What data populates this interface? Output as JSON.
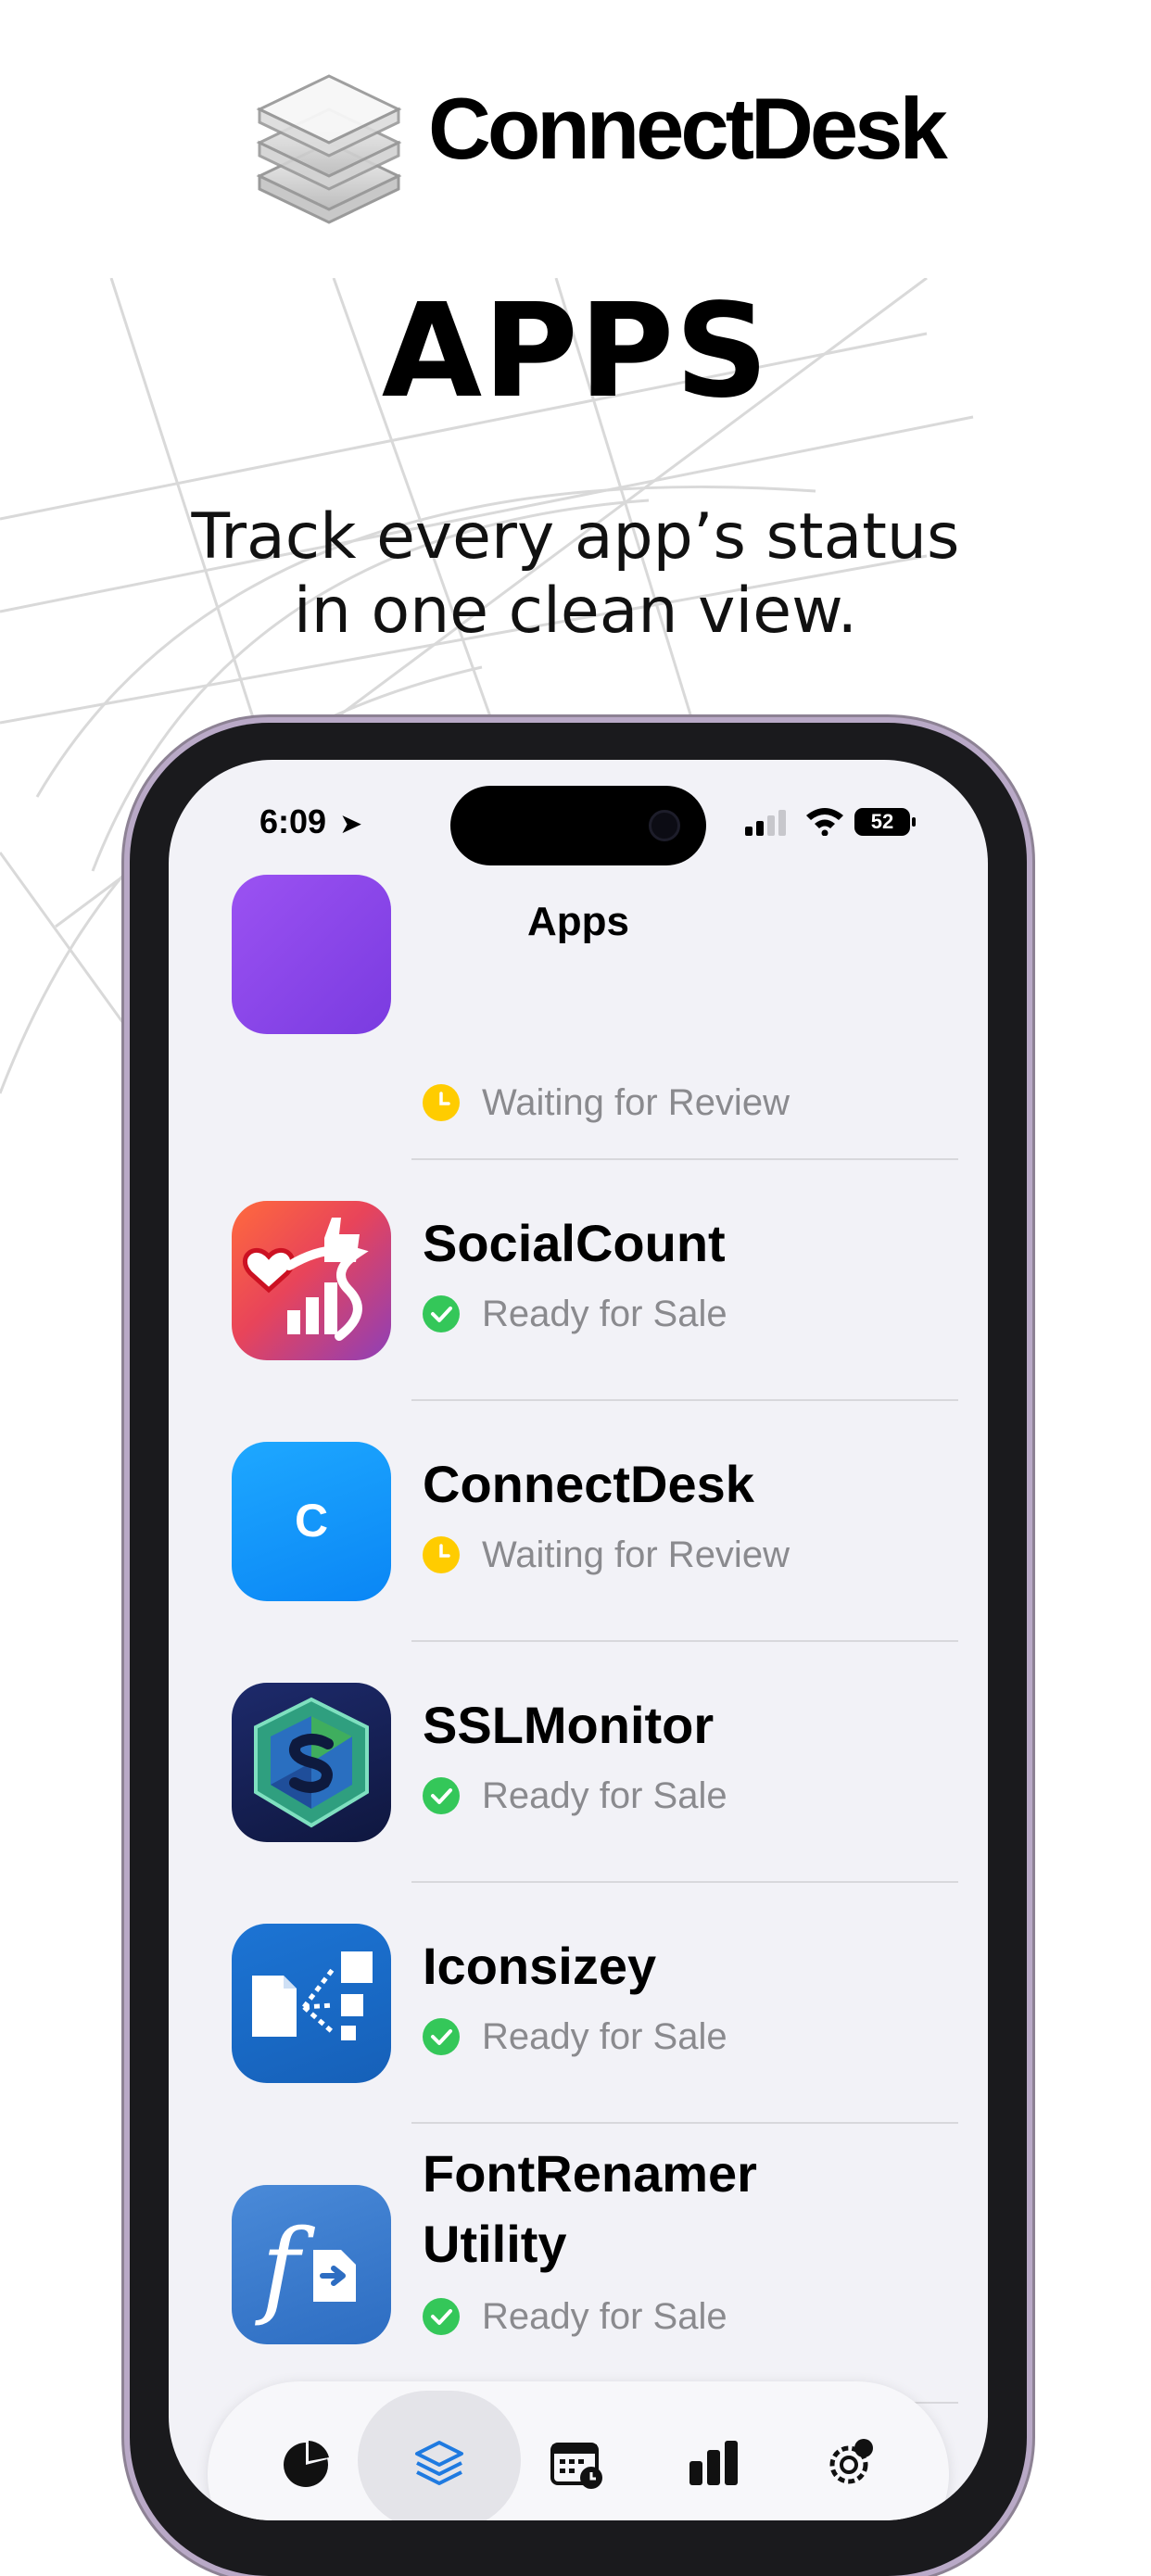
{
  "brand": {
    "name": "ConnectDesk",
    "logo": "stacked-layers-logo"
  },
  "hero": {
    "title": "APPS",
    "subtitle_lines": [
      "Track every app’s status",
      "in one clean view."
    ]
  },
  "status_bar": {
    "time": "6:09",
    "location_icon": "location-arrow-icon",
    "battery": "52"
  },
  "nav": {
    "title": "Apps"
  },
  "apps": [
    {
      "name": "",
      "status": "Waiting for Review",
      "status_color": "#ffcc00",
      "icon": "purple-app-icon"
    },
    {
      "name": "SocialCount",
      "status": "Ready for Sale",
      "status_color": "#34c759",
      "icon": "socialcount-icon"
    },
    {
      "name": "ConnectDesk",
      "status": "Waiting for Review",
      "status_color": "#ffcc00",
      "icon": "connectdesk-c-icon",
      "icon_letter": "C"
    },
    {
      "name": "SSLMonitor",
      "status": "Ready for Sale",
      "status_color": "#34c759",
      "icon": "sslmonitor-shield-icon"
    },
    {
      "name": "Iconsizey",
      "status": "Ready for Sale",
      "status_color": "#34c759",
      "icon": "iconsizey-icon"
    },
    {
      "name_lines": [
        "FontRenamer",
        "Utility"
      ],
      "status": "Ready for Sale",
      "status_color": "#34c759",
      "icon": "fontrenamer-icon"
    }
  ],
  "tabs": [
    {
      "icon": "pie-chart-icon",
      "active": false
    },
    {
      "icon": "layers-icon",
      "active": true
    },
    {
      "icon": "calendar-clock-icon",
      "active": false
    },
    {
      "icon": "bar-chart-icon",
      "active": false
    },
    {
      "icon": "gear-person-icon",
      "active": false
    }
  ],
  "colors": {
    "accent": "#1f7ae0",
    "ready": "#34c759",
    "waiting": "#ffcc00",
    "screen_bg": "#f2f2f7"
  }
}
